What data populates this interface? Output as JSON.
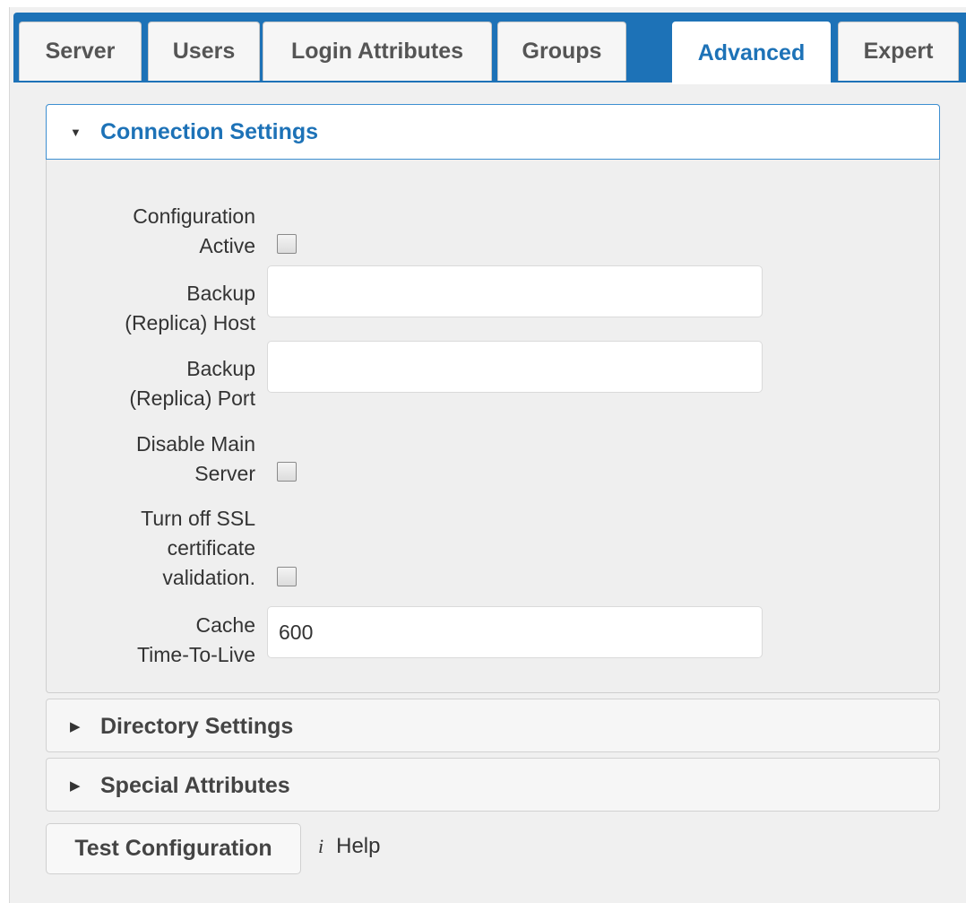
{
  "tabs": [
    {
      "label": "Server"
    },
    {
      "label": "Users"
    },
    {
      "label": "Login Attributes"
    },
    {
      "label": "Groups"
    },
    {
      "label": "Advanced",
      "active": true
    },
    {
      "label": "Expert"
    }
  ],
  "connection_settings": {
    "title": "Connection Settings",
    "fields": {
      "configuration_active": {
        "label_1": "Configuration",
        "label_2": "Active",
        "checked": false
      },
      "backup_host": {
        "label_1": "Backup",
        "label_2": "(Replica) Host",
        "value": ""
      },
      "backup_port": {
        "label_1": "Backup",
        "label_2": "(Replica) Port",
        "value": ""
      },
      "disable_main_server": {
        "label_1": "Disable Main",
        "label_2": "Server",
        "checked": false
      },
      "turn_off_ssl": {
        "label_1": "Turn off SSL",
        "label_2": "certificate",
        "label_3": "validation.",
        "checked": false
      },
      "cache_ttl": {
        "label_1": "Cache",
        "label_2": "Time-To-Live",
        "value": "600"
      }
    }
  },
  "directory_settings": {
    "title": "Directory Settings"
  },
  "special_attributes": {
    "title": "Special Attributes"
  },
  "actions": {
    "test_configuration": "Test Configuration",
    "help_label": "Help",
    "help_icon_glyph": "i"
  },
  "colors": {
    "accent": "#1d72b7",
    "panel_bg": "#efefef"
  }
}
